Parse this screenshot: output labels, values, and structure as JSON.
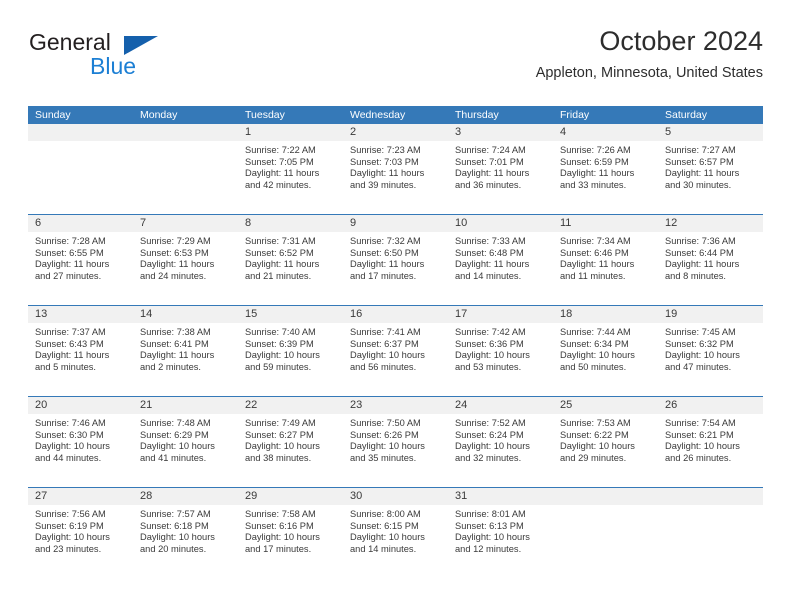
{
  "brand": {
    "name_part1": "General",
    "name_part2": "Blue",
    "triangle_color": "#1560ac",
    "blue_text_color": "#1c7fd4"
  },
  "header": {
    "title": "October 2024",
    "subtitle": "Appleton, Minnesota, United States"
  },
  "theme": {
    "header_blue": "#3579b8",
    "daynum_band": "#f1f1f1",
    "text": "#3a3a3a"
  },
  "weekdays": [
    "Sunday",
    "Monday",
    "Tuesday",
    "Wednesday",
    "Thursday",
    "Friday",
    "Saturday"
  ],
  "weeks": [
    [
      {
        "day": "",
        "sunrise": "",
        "sunset": "",
        "daylight_1": "",
        "daylight_2": ""
      },
      {
        "day": "",
        "sunrise": "",
        "sunset": "",
        "daylight_1": "",
        "daylight_2": ""
      },
      {
        "day": "1",
        "sunrise": "Sunrise: 7:22 AM",
        "sunset": "Sunset: 7:05 PM",
        "daylight_1": "Daylight: 11 hours",
        "daylight_2": "and 42 minutes."
      },
      {
        "day": "2",
        "sunrise": "Sunrise: 7:23 AM",
        "sunset": "Sunset: 7:03 PM",
        "daylight_1": "Daylight: 11 hours",
        "daylight_2": "and 39 minutes."
      },
      {
        "day": "3",
        "sunrise": "Sunrise: 7:24 AM",
        "sunset": "Sunset: 7:01 PM",
        "daylight_1": "Daylight: 11 hours",
        "daylight_2": "and 36 minutes."
      },
      {
        "day": "4",
        "sunrise": "Sunrise: 7:26 AM",
        "sunset": "Sunset: 6:59 PM",
        "daylight_1": "Daylight: 11 hours",
        "daylight_2": "and 33 minutes."
      },
      {
        "day": "5",
        "sunrise": "Sunrise: 7:27 AM",
        "sunset": "Sunset: 6:57 PM",
        "daylight_1": "Daylight: 11 hours",
        "daylight_2": "and 30 minutes."
      }
    ],
    [
      {
        "day": "6",
        "sunrise": "Sunrise: 7:28 AM",
        "sunset": "Sunset: 6:55 PM",
        "daylight_1": "Daylight: 11 hours",
        "daylight_2": "and 27 minutes."
      },
      {
        "day": "7",
        "sunrise": "Sunrise: 7:29 AM",
        "sunset": "Sunset: 6:53 PM",
        "daylight_1": "Daylight: 11 hours",
        "daylight_2": "and 24 minutes."
      },
      {
        "day": "8",
        "sunrise": "Sunrise: 7:31 AM",
        "sunset": "Sunset: 6:52 PM",
        "daylight_1": "Daylight: 11 hours",
        "daylight_2": "and 21 minutes."
      },
      {
        "day": "9",
        "sunrise": "Sunrise: 7:32 AM",
        "sunset": "Sunset: 6:50 PM",
        "daylight_1": "Daylight: 11 hours",
        "daylight_2": "and 17 minutes."
      },
      {
        "day": "10",
        "sunrise": "Sunrise: 7:33 AM",
        "sunset": "Sunset: 6:48 PM",
        "daylight_1": "Daylight: 11 hours",
        "daylight_2": "and 14 minutes."
      },
      {
        "day": "11",
        "sunrise": "Sunrise: 7:34 AM",
        "sunset": "Sunset: 6:46 PM",
        "daylight_1": "Daylight: 11 hours",
        "daylight_2": "and 11 minutes."
      },
      {
        "day": "12",
        "sunrise": "Sunrise: 7:36 AM",
        "sunset": "Sunset: 6:44 PM",
        "daylight_1": "Daylight: 11 hours",
        "daylight_2": "and 8 minutes."
      }
    ],
    [
      {
        "day": "13",
        "sunrise": "Sunrise: 7:37 AM",
        "sunset": "Sunset: 6:43 PM",
        "daylight_1": "Daylight: 11 hours",
        "daylight_2": "and 5 minutes."
      },
      {
        "day": "14",
        "sunrise": "Sunrise: 7:38 AM",
        "sunset": "Sunset: 6:41 PM",
        "daylight_1": "Daylight: 11 hours",
        "daylight_2": "and 2 minutes."
      },
      {
        "day": "15",
        "sunrise": "Sunrise: 7:40 AM",
        "sunset": "Sunset: 6:39 PM",
        "daylight_1": "Daylight: 10 hours",
        "daylight_2": "and 59 minutes."
      },
      {
        "day": "16",
        "sunrise": "Sunrise: 7:41 AM",
        "sunset": "Sunset: 6:37 PM",
        "daylight_1": "Daylight: 10 hours",
        "daylight_2": "and 56 minutes."
      },
      {
        "day": "17",
        "sunrise": "Sunrise: 7:42 AM",
        "sunset": "Sunset: 6:36 PM",
        "daylight_1": "Daylight: 10 hours",
        "daylight_2": "and 53 minutes."
      },
      {
        "day": "18",
        "sunrise": "Sunrise: 7:44 AM",
        "sunset": "Sunset: 6:34 PM",
        "daylight_1": "Daylight: 10 hours",
        "daylight_2": "and 50 minutes."
      },
      {
        "day": "19",
        "sunrise": "Sunrise: 7:45 AM",
        "sunset": "Sunset: 6:32 PM",
        "daylight_1": "Daylight: 10 hours",
        "daylight_2": "and 47 minutes."
      }
    ],
    [
      {
        "day": "20",
        "sunrise": "Sunrise: 7:46 AM",
        "sunset": "Sunset: 6:30 PM",
        "daylight_1": "Daylight: 10 hours",
        "daylight_2": "and 44 minutes."
      },
      {
        "day": "21",
        "sunrise": "Sunrise: 7:48 AM",
        "sunset": "Sunset: 6:29 PM",
        "daylight_1": "Daylight: 10 hours",
        "daylight_2": "and 41 minutes."
      },
      {
        "day": "22",
        "sunrise": "Sunrise: 7:49 AM",
        "sunset": "Sunset: 6:27 PM",
        "daylight_1": "Daylight: 10 hours",
        "daylight_2": "and 38 minutes."
      },
      {
        "day": "23",
        "sunrise": "Sunrise: 7:50 AM",
        "sunset": "Sunset: 6:26 PM",
        "daylight_1": "Daylight: 10 hours",
        "daylight_2": "and 35 minutes."
      },
      {
        "day": "24",
        "sunrise": "Sunrise: 7:52 AM",
        "sunset": "Sunset: 6:24 PM",
        "daylight_1": "Daylight: 10 hours",
        "daylight_2": "and 32 minutes."
      },
      {
        "day": "25",
        "sunrise": "Sunrise: 7:53 AM",
        "sunset": "Sunset: 6:22 PM",
        "daylight_1": "Daylight: 10 hours",
        "daylight_2": "and 29 minutes."
      },
      {
        "day": "26",
        "sunrise": "Sunrise: 7:54 AM",
        "sunset": "Sunset: 6:21 PM",
        "daylight_1": "Daylight: 10 hours",
        "daylight_2": "and 26 minutes."
      }
    ],
    [
      {
        "day": "27",
        "sunrise": "Sunrise: 7:56 AM",
        "sunset": "Sunset: 6:19 PM",
        "daylight_1": "Daylight: 10 hours",
        "daylight_2": "and 23 minutes."
      },
      {
        "day": "28",
        "sunrise": "Sunrise: 7:57 AM",
        "sunset": "Sunset: 6:18 PM",
        "daylight_1": "Daylight: 10 hours",
        "daylight_2": "and 20 minutes."
      },
      {
        "day": "29",
        "sunrise": "Sunrise: 7:58 AM",
        "sunset": "Sunset: 6:16 PM",
        "daylight_1": "Daylight: 10 hours",
        "daylight_2": "and 17 minutes."
      },
      {
        "day": "30",
        "sunrise": "Sunrise: 8:00 AM",
        "sunset": "Sunset: 6:15 PM",
        "daylight_1": "Daylight: 10 hours",
        "daylight_2": "and 14 minutes."
      },
      {
        "day": "31",
        "sunrise": "Sunrise: 8:01 AM",
        "sunset": "Sunset: 6:13 PM",
        "daylight_1": "Daylight: 10 hours",
        "daylight_2": "and 12 minutes."
      },
      {
        "day": "",
        "sunrise": "",
        "sunset": "",
        "daylight_1": "",
        "daylight_2": ""
      },
      {
        "day": "",
        "sunrise": "",
        "sunset": "",
        "daylight_1": "",
        "daylight_2": ""
      }
    ]
  ]
}
